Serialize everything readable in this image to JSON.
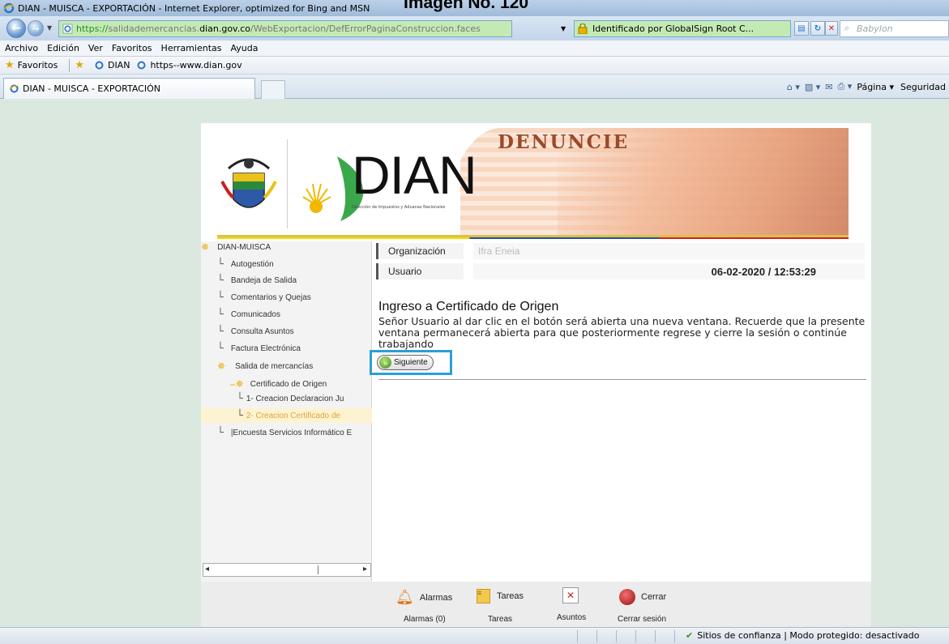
{
  "caption": "Imagen No. 120",
  "window": {
    "title": "DIAN - MUISCA - EXPORTACIÓN - Internet Explorer, optimized for Bing and MSN"
  },
  "address": {
    "url_proto": "https://",
    "url_host_pre": "salidademercancias.",
    "url_host": "dian.gov.co",
    "url_path": "/WebExportacion/DefErrorPaginaConstruccion.faces",
    "security_label": "Identificado por GlobalSign Root C...",
    "search_placeholder": "Babylon"
  },
  "menu": [
    "Archivo",
    "Edición",
    "Ver",
    "Favoritos",
    "Herramientas",
    "Ayuda"
  ],
  "favorites": {
    "label": "Favoritos",
    "links": [
      "DIAN",
      "https--www.dian.gov"
    ]
  },
  "tabs": [
    {
      "label": "DIAN - MUISCA - EXPORTACIÓN"
    }
  ],
  "commandbar": {
    "page_label": "Página",
    "security_label": "Seguridad"
  },
  "banner": {
    "denuncie": "DENUNCIE",
    "dian_word": "DIAN",
    "slogan": "Dirección de Impuestos y Aduanas Nacionales"
  },
  "sidenav": {
    "root": "DIAN-MUISCA",
    "items": [
      "Autogestión",
      "Bandeja de Salida",
      "Comentarios y Quejas",
      "Comunicados",
      "Consulta Asuntos",
      "Factura Electrónica",
      "Salida de mercancías",
      "Certificado de Origen",
      "1- Creacion Declaracion Ju",
      "2- Creacion Certificado de",
      "|Encuesta Servicios Informático E"
    ]
  },
  "info": {
    "org_label": "Organización",
    "org_value": "Ifra Eneia",
    "user_label": "Usuario",
    "datetime": "06-02-2020 / 12:53:29"
  },
  "main": {
    "title": "Ingreso a Certificado de Origen",
    "text": "Señor Usuario al dar clic en el botón será abierta una nueva ventana. Recuerde que la presente ventana permanecerá abierta para que posteriormente regrese y cierre la sesión o continúe trabajando",
    "next_button": "Siguiente"
  },
  "footer": {
    "alarmas": "Alarmas",
    "alarmas_sub": "Alarmas (0)",
    "tareas": "Tareas",
    "tareas_sub": "Tareas",
    "asuntos_sub": "Asuntos",
    "cerrar": "Cerrar",
    "cerrar_sub": "Cerrar sesión"
  },
  "status": {
    "text": "Sitios de confianza | Modo protegido: desactivado"
  },
  "colors": {
    "highlight_border": "#2aa0d6",
    "address_green": "#c4eab4",
    "nav_selected": "#fdf3d0",
    "nav_selected_text": "#e0a040"
  }
}
